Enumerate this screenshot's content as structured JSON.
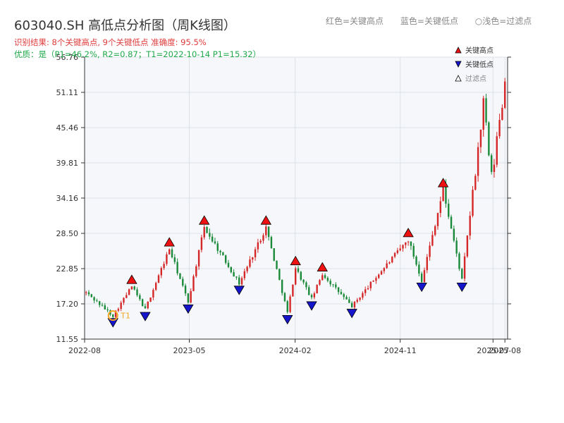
{
  "title": "603040.SH 高低点分析图（周K线图）",
  "hint": {
    "red": "红色=关键高点",
    "blue": "蓝色=关键低点",
    "hollow": "○浅色=过滤点"
  },
  "result_line": "识别结果: 8个关键高点, 9个关键低点 准确度: 95.5%",
  "quality_line": "优质：是（P1=46.2%, R2=0.87；T1=2022-10-14 P1=15.32）",
  "legend": {
    "high": "关键高点",
    "low": "关键低点",
    "filtered": "过滤点"
  },
  "colors": {
    "up": "#d62728",
    "down": "#1a8a3a",
    "high_marker": "#ee1111",
    "low_marker": "#1515cc",
    "t1": "#f5a623"
  },
  "chart_data": {
    "type": "candlestick",
    "x_axis": "date",
    "x_ticks": [
      "2022-08",
      "2023-05",
      "2024-02",
      "2024-11",
      "2025-07",
      "2025-08"
    ],
    "y_ticks": [
      "11.55",
      "17.20",
      "22.85",
      "28.50",
      "34.16",
      "39.81",
      "45.46",
      "51.11",
      "56.76"
    ],
    "ylim": [
      11.55,
      56.76
    ],
    "xlim": [
      "2022-08-01",
      "2025-08-08"
    ],
    "grid": true,
    "legend_position": "top-right",
    "anchors": [
      [
        "2022-08-05",
        19.0
      ],
      [
        "2022-10-14",
        15.3
      ],
      [
        "2022-12-02",
        20.0
      ],
      [
        "2023-01-06",
        16.3
      ],
      [
        "2023-03-10",
        26.0
      ],
      [
        "2023-04-28",
        17.5
      ],
      [
        "2023-06-09",
        29.5
      ],
      [
        "2023-09-08",
        20.5
      ],
      [
        "2023-11-17",
        29.5
      ],
      [
        "2024-01-12",
        15.8
      ],
      [
        "2024-02-02",
        23.0
      ],
      [
        "2024-03-15",
        18.0
      ],
      [
        "2024-04-12",
        22.0
      ],
      [
        "2024-06-28",
        16.8
      ],
      [
        "2024-09-06",
        22.0
      ],
      [
        "2024-11-22",
        27.5
      ],
      [
        "2024-12-27",
        21.0
      ],
      [
        "2025-02-21",
        35.5
      ],
      [
        "2025-04-11",
        21.0
      ],
      [
        "2025-06-06",
        49.0
      ],
      [
        "2025-06-27",
        37.0
      ],
      [
        "2025-08-01",
        53.0
      ]
    ],
    "key_highs": [
      {
        "date": "2022-12-02",
        "value": 20.0
      },
      {
        "date": "2023-03-10",
        "value": 26.0
      },
      {
        "date": "2023-06-09",
        "value": 29.5
      },
      {
        "date": "2023-11-17",
        "value": 29.5
      },
      {
        "date": "2024-02-02",
        "value": 23.0
      },
      {
        "date": "2024-04-12",
        "value": 22.0
      },
      {
        "date": "2024-11-22",
        "value": 27.5
      },
      {
        "date": "2025-02-21",
        "value": 35.5
      }
    ],
    "key_lows": [
      {
        "date": "2022-10-14",
        "value": 15.3
      },
      {
        "date": "2023-01-06",
        "value": 16.3
      },
      {
        "date": "2023-04-28",
        "value": 17.5
      },
      {
        "date": "2023-09-08",
        "value": 20.5
      },
      {
        "date": "2024-01-12",
        "value": 15.8
      },
      {
        "date": "2024-03-15",
        "value": 18.0
      },
      {
        "date": "2024-06-28",
        "value": 16.8
      },
      {
        "date": "2024-12-27",
        "value": 21.0
      },
      {
        "date": "2025-04-11",
        "value": 21.0
      }
    ],
    "t1": {
      "label": "T1",
      "date": "2022-10-14",
      "value": 15.32
    }
  }
}
